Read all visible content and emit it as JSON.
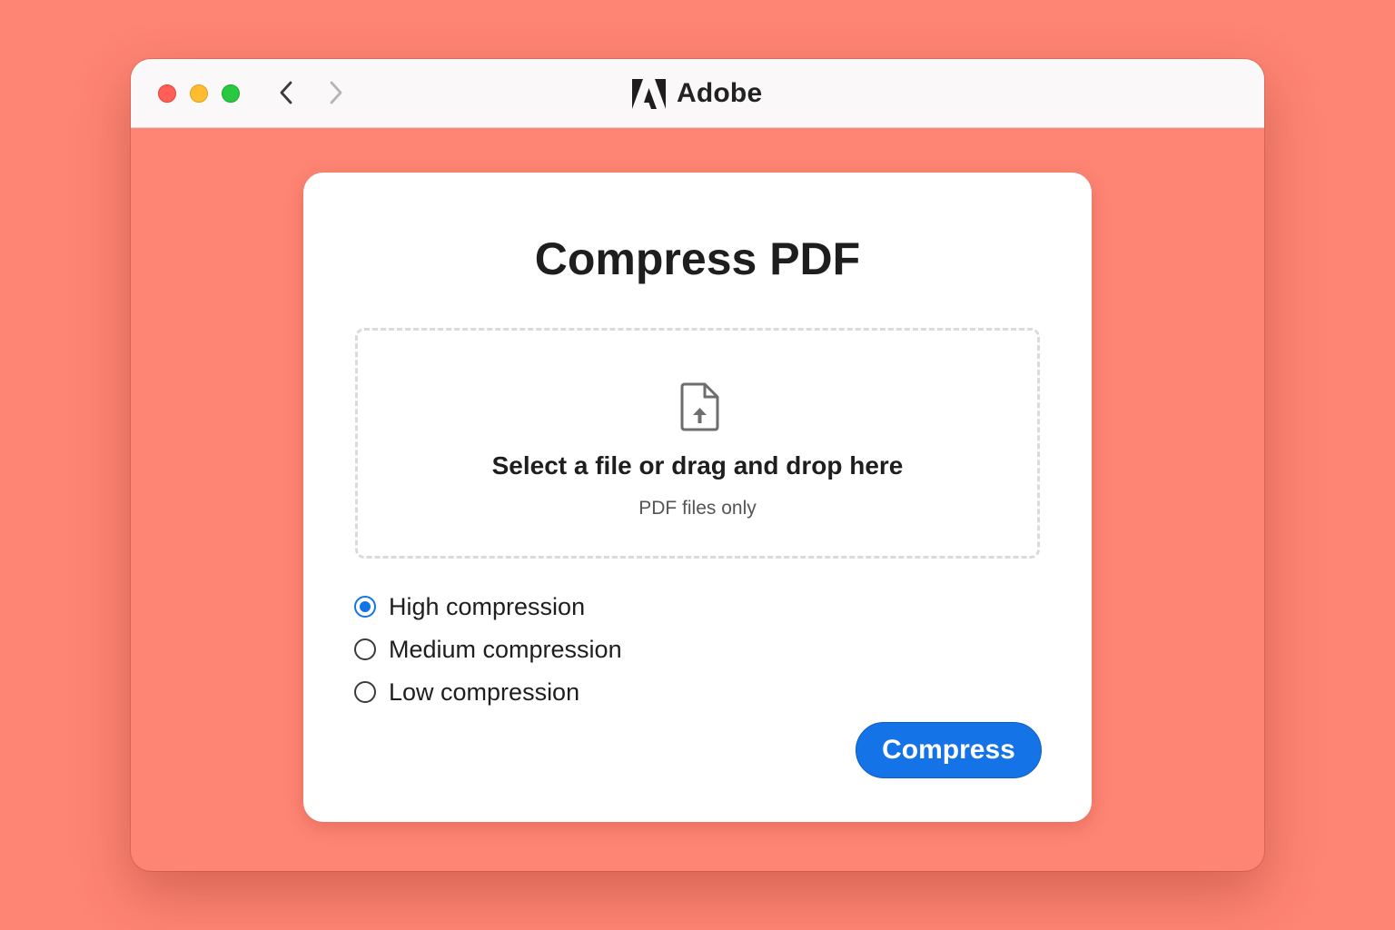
{
  "window": {
    "brand": "Adobe",
    "brand_icon": "adobe-logo-icon",
    "nav": {
      "back_icon": "chevron-left-icon",
      "forward_icon": "chevron-right-icon"
    }
  },
  "card": {
    "title": "Compress PDF",
    "dropzone": {
      "icon": "file-upload-icon",
      "main_text": "Select a file or drag and drop here",
      "sub_text": "PDF files only"
    },
    "options": [
      {
        "label": "High compression",
        "selected": true
      },
      {
        "label": "Medium compression",
        "selected": false
      },
      {
        "label": "Low compression",
        "selected": false
      }
    ],
    "action_label": "Compress"
  },
  "colors": {
    "background": "#FE8473",
    "accent": "#1473E6",
    "titlebar": "#FAF8F8"
  }
}
